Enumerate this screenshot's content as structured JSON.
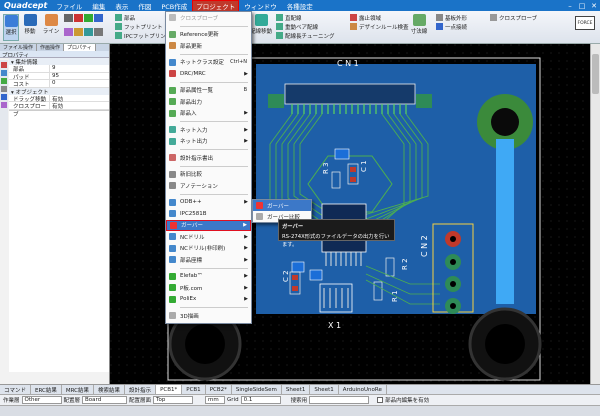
{
  "app": {
    "logo": "Quadcept"
  },
  "menubar": [
    {
      "label": "ファイル"
    },
    {
      "label": "編集"
    },
    {
      "label": "表示"
    },
    {
      "label": "作図"
    },
    {
      "label": "PCB作成"
    },
    {
      "label": "プロジェクト",
      "active": true
    },
    {
      "label": "ウィンドウ"
    },
    {
      "label": "各種設定"
    }
  ],
  "ribbon": {
    "big": [
      {
        "label": "選択"
      },
      {
        "label": "移動"
      },
      {
        "label": "ライン"
      }
    ],
    "small_left": [
      "部品",
      "フットプリント",
      "IPCフットプリント"
    ],
    "right": [
      "直配線",
      "重動ベア配線",
      "配線長チューニング",
      "露止領域",
      "デザインルール検査",
      "寸法線",
      "基板外形",
      "一点接続",
      "クロスプローブ"
    ],
    "right_big": "配線移動"
  },
  "leftpanel": {
    "tabs": [
      "ファイル操作",
      "作画操作",
      "プロパティ"
    ],
    "title": "プロパティ",
    "sections": [
      {
        "name": "集計情報",
        "rows": [
          {
            "k": "部品",
            "v": "9"
          },
          {
            "k": "パッド",
            "v": "95"
          },
          {
            "k": "コスト",
            "v": "0"
          }
        ]
      },
      {
        "name": "オブジェクト",
        "rows": [
          {
            "k": "ドラッグ移動",
            "v": "有効"
          },
          {
            "k": "クロスプローブ",
            "v": "有効"
          }
        ]
      }
    ]
  },
  "dropdown": {
    "items": [
      {
        "label": "クロスプローブ",
        "dis": true,
        "color": "#bbb"
      },
      {
        "sep": true
      },
      {
        "label": "Reference更新",
        "color": "#6a6"
      },
      {
        "label": "部品更新",
        "color": "#c84"
      },
      {
        "sep": true
      },
      {
        "label": "ネットクラス設定",
        "shortcut": "Ctrl+N",
        "color": "#48c"
      },
      {
        "label": "DRC/MRC",
        "arrow": true,
        "color": "#c44"
      },
      {
        "sep": true
      },
      {
        "label": "部品属性一覧",
        "shortcut": "B",
        "color": "#5a5"
      },
      {
        "label": "部品出力",
        "color": "#5a5"
      },
      {
        "label": "部品入",
        "arrow": true,
        "color": "#5a5"
      },
      {
        "sep": true
      },
      {
        "label": "ネット入力",
        "arrow": true,
        "color": "#4a9"
      },
      {
        "label": "ネット出力",
        "arrow": true,
        "color": "#4a9"
      },
      {
        "sep": true
      },
      {
        "label": "設計指示書出",
        "color": "#c66"
      },
      {
        "sep": true
      },
      {
        "label": "新旧比較",
        "color": "#888"
      },
      {
        "label": "アノテーション",
        "color": "#888"
      },
      {
        "sep": true
      },
      {
        "label": "ODB++",
        "arrow": true,
        "color": "#48c"
      },
      {
        "label": "IPC2581B",
        "color": "#48c"
      },
      {
        "label": "ガーバー",
        "arrow": true,
        "hl": true,
        "color": "#e33"
      },
      {
        "label": "NCドリル",
        "arrow": true,
        "color": "#48c"
      },
      {
        "label": "NCドリル(非印刷)",
        "arrow": true,
        "color": "#48c"
      },
      {
        "label": "部品座標",
        "arrow": true,
        "color": "#48c"
      },
      {
        "sep": true
      },
      {
        "label": "Elefab™",
        "arrow": true,
        "color": "#3a3"
      },
      {
        "label": "P板.com",
        "arrow": true,
        "color": "#3a3"
      },
      {
        "label": "PoliEx",
        "arrow": true,
        "color": "#3a3"
      },
      {
        "sep": true
      },
      {
        "label": "3D描画",
        "color": "#aaa"
      }
    ]
  },
  "submenu": {
    "items": [
      {
        "label": "ガーバー",
        "hl": true
      },
      {
        "label": "ガーバー比較"
      }
    ]
  },
  "tooltip": {
    "title": "ガーバー",
    "text": "RS-274X形式のファイルデータの出力を行います。"
  },
  "pcb_labels": {
    "cn1": "C N 1",
    "cn2": "C N 2",
    "x1": "X 1",
    "c1": "C 1",
    "c2": "C 2",
    "r1": "R 1",
    "r2": "R 2",
    "r3": "R 3"
  },
  "bottomtabs": [
    "コマンド",
    "ERC結果",
    "MRC結果",
    "検索結果",
    "設計指示",
    "PCB1*",
    "PCB1",
    "PCB2*",
    "SingleSideSem",
    "Sheet1",
    "Sheet1",
    "ArduinoUnoRe"
  ],
  "statusbar": {
    "layer_label": "作業層",
    "layer": "Other",
    "board_label": "配置層",
    "board": "Board",
    "side_label": "配置層面",
    "side": "Top",
    "unit": "mm",
    "grid_label": "Grid",
    "grid": "0.1",
    "search_label": "搜索用",
    "check_label": "部品内編集を有効"
  }
}
